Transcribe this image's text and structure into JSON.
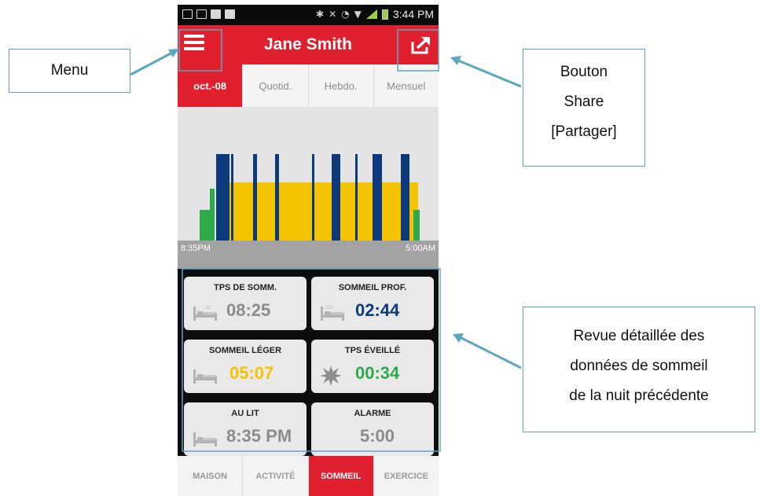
{
  "status_bar": {
    "time": "3:44 PM"
  },
  "app": {
    "title": "Jane Smith"
  },
  "tabs": [
    {
      "label": "oct.-08",
      "active": true
    },
    {
      "label": "Quotid.",
      "active": false
    },
    {
      "label": "Hebdo.",
      "active": false
    },
    {
      "label": "Mensuel",
      "active": false
    }
  ],
  "timeline": {
    "start": "8:35PM",
    "end": "5:00AM"
  },
  "cards": {
    "sleep_time": {
      "label": "TPS DE SOMM.",
      "value": "08:25"
    },
    "deep_sleep": {
      "label": "SOMMEIL PROF.",
      "value": "02:44"
    },
    "light_sleep": {
      "label": "SOMMEIL LÉGER",
      "value": "05:07"
    },
    "awake_time": {
      "label": "TPS ÉVEILLÉ",
      "value": "00:34"
    },
    "in_bed": {
      "label": "AU LIT",
      "value": "8:35 PM"
    },
    "alarm": {
      "label": "ALARME",
      "value": "5:00"
    }
  },
  "bottom_nav": [
    {
      "label": "MAISON",
      "active": false
    },
    {
      "label": "ACTIVITÉ",
      "active": false
    },
    {
      "label": "SOMMEIL",
      "active": true
    },
    {
      "label": "EXERCICE",
      "active": false
    }
  ],
  "annotations": {
    "menu": "Menu",
    "share": [
      "Bouton",
      "Share",
      "[Partager]"
    ],
    "review": [
      "Revue détaillée des",
      "données de sommeil",
      "de la nuit précédente"
    ]
  },
  "colors": {
    "brand_red": "#e0202e",
    "deep_sleep": "#0c3a7a",
    "light_sleep": "#f5c400",
    "awake": "#2eaa4a",
    "callout_border": "#5aa7be"
  },
  "icons": {
    "menu": "hamburger-icon",
    "share": "share-icon",
    "bed": "bed-icon",
    "awake": "starburst-icon"
  }
}
